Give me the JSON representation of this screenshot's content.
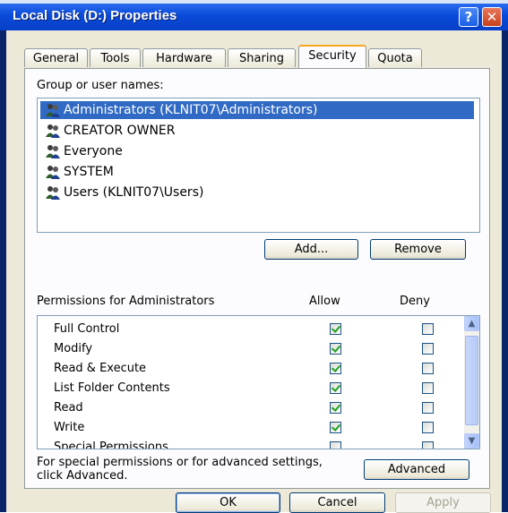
{
  "window": {
    "title": "Local Disk (D:) Properties"
  },
  "title_buttons": {
    "help": "?",
    "close": "✕"
  },
  "tabs": [
    {
      "label": "General"
    },
    {
      "label": "Tools"
    },
    {
      "label": "Hardware"
    },
    {
      "label": "Sharing"
    },
    {
      "label": "Security",
      "active": true
    },
    {
      "label": "Quota"
    }
  ],
  "security": {
    "group_label": "Group or user names:",
    "users": [
      {
        "name": "Administrators (KLNIT07\\Administrators)",
        "selected": true
      },
      {
        "name": "CREATOR OWNER"
      },
      {
        "name": "Everyone"
      },
      {
        "name": "SYSTEM"
      },
      {
        "name": "Users (KLNIT07\\Users)"
      }
    ],
    "add_button": "Add...",
    "remove_button": "Remove",
    "permissions_label": "Permissions for Administrators",
    "allow_header": "Allow",
    "deny_header": "Deny",
    "permissions": [
      {
        "name": "Full Control",
        "allow": true,
        "deny": false
      },
      {
        "name": "Modify",
        "allow": true,
        "deny": false
      },
      {
        "name": "Read & Execute",
        "allow": true,
        "deny": false
      },
      {
        "name": "List Folder Contents",
        "allow": true,
        "deny": false
      },
      {
        "name": "Read",
        "allow": true,
        "deny": false
      },
      {
        "name": "Write",
        "allow": true,
        "deny": false
      },
      {
        "name": "Special Permissions",
        "allow": false,
        "deny": false
      }
    ],
    "advanced_text": "For special permissions or for advanced settings, click Advanced.",
    "advanced_button": "Advanced"
  },
  "footer": {
    "ok": "OK",
    "cancel": "Cancel",
    "apply": "Apply"
  }
}
